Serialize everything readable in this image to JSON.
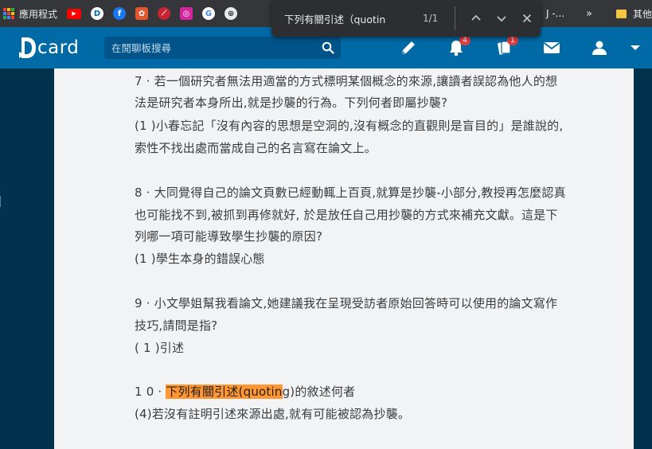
{
  "bookmarks": {
    "apps_label": "應用程式",
    "more": "»",
    "other_label": "其他書",
    "overflow_text": "J -...",
    "favicons": [
      {
        "name": "youtube",
        "glyph": "▶",
        "color": "#ff0000"
      },
      {
        "name": "dcard",
        "glyph": "D",
        "color": "#006aa6"
      },
      {
        "name": "facebook",
        "glyph": "f",
        "color": "#1877f2"
      },
      {
        "name": "shopping-bag",
        "glyph": "⬧",
        "color": "#e4572e"
      },
      {
        "name": "bookmark-red",
        "glyph": "⟋",
        "color": "#c82333"
      },
      {
        "name": "instagram",
        "glyph": "◎",
        "color": "#d6249f"
      },
      {
        "name": "google",
        "glyph": "G",
        "color": "#ffffff"
      },
      {
        "name": "globe",
        "glyph": "⊕",
        "color": "#9aa0a6"
      }
    ]
  },
  "find_bar": {
    "query": "下列有關引述（quotin",
    "count": "1/1"
  },
  "header": {
    "logo_text": "card",
    "search_placeholder": "在閒聊板搜尋",
    "notification_count": "4",
    "cards_count": "1"
  },
  "post": {
    "q7": {
      "line1": "7 · 若一個研究者無法用適當的方式標明某個概念的來源,讓讀者誤認為他人的想",
      "line2": "法是研究者本身所出,就是抄襲的行為。下列何者即屬抄襲?",
      "line3": " (1 )小春忘記「沒有內容的思想是空洞的,沒有概念的直觀則是盲目的」是誰說的,",
      "line4": "索性不找出處而當成自己的名言寫在論文上。"
    },
    "q8": {
      "line1": "8 · 大同覺得自己的論文頁數已經動輒上百頁,就算是抄襲-小部分,教授再怎麼認真",
      "line2": "也可能找不到,被抓到再修就好, 於是放任自己用抄襲的方式來補充文獻。這是下",
      "line3": "列哪一項可能導致學生抄襲的原因?",
      "line4": "(1 )學生本身的錯誤心態"
    },
    "q9": {
      "line1": "9 · 小文學姐幫我看論文,她建議我在呈現受訪者原始回答時可以使用的論文寫作",
      "line2": "技巧,請問是指?",
      "line3": " ( 1 )引述"
    },
    "q10": {
      "prefix": "1 0 · ",
      "highlight": "下列有關引述(quotin",
      "suffix": "g)的敘述何者",
      "answer": "(4)若沒有註明引述來源出處,就有可能被認為抄襲。"
    }
  }
}
